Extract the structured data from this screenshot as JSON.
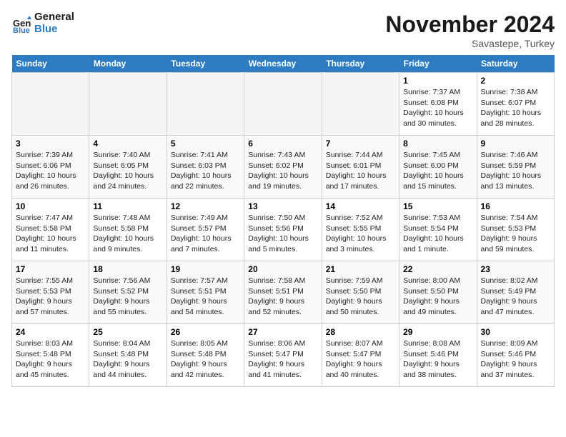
{
  "header": {
    "logo_line1": "General",
    "logo_line2": "Blue",
    "month": "November 2024",
    "location": "Savastepe, Turkey"
  },
  "days_of_week": [
    "Sunday",
    "Monday",
    "Tuesday",
    "Wednesday",
    "Thursday",
    "Friday",
    "Saturday"
  ],
  "weeks": [
    [
      {
        "day": "",
        "info": ""
      },
      {
        "day": "",
        "info": ""
      },
      {
        "day": "",
        "info": ""
      },
      {
        "day": "",
        "info": ""
      },
      {
        "day": "",
        "info": ""
      },
      {
        "day": "1",
        "info": "Sunrise: 7:37 AM\nSunset: 6:08 PM\nDaylight: 10 hours and 30 minutes."
      },
      {
        "day": "2",
        "info": "Sunrise: 7:38 AM\nSunset: 6:07 PM\nDaylight: 10 hours and 28 minutes."
      }
    ],
    [
      {
        "day": "3",
        "info": "Sunrise: 7:39 AM\nSunset: 6:06 PM\nDaylight: 10 hours and 26 minutes."
      },
      {
        "day": "4",
        "info": "Sunrise: 7:40 AM\nSunset: 6:05 PM\nDaylight: 10 hours and 24 minutes."
      },
      {
        "day": "5",
        "info": "Sunrise: 7:41 AM\nSunset: 6:03 PM\nDaylight: 10 hours and 22 minutes."
      },
      {
        "day": "6",
        "info": "Sunrise: 7:43 AM\nSunset: 6:02 PM\nDaylight: 10 hours and 19 minutes."
      },
      {
        "day": "7",
        "info": "Sunrise: 7:44 AM\nSunset: 6:01 PM\nDaylight: 10 hours and 17 minutes."
      },
      {
        "day": "8",
        "info": "Sunrise: 7:45 AM\nSunset: 6:00 PM\nDaylight: 10 hours and 15 minutes."
      },
      {
        "day": "9",
        "info": "Sunrise: 7:46 AM\nSunset: 5:59 PM\nDaylight: 10 hours and 13 minutes."
      }
    ],
    [
      {
        "day": "10",
        "info": "Sunrise: 7:47 AM\nSunset: 5:58 PM\nDaylight: 10 hours and 11 minutes."
      },
      {
        "day": "11",
        "info": "Sunrise: 7:48 AM\nSunset: 5:58 PM\nDaylight: 10 hours and 9 minutes."
      },
      {
        "day": "12",
        "info": "Sunrise: 7:49 AM\nSunset: 5:57 PM\nDaylight: 10 hours and 7 minutes."
      },
      {
        "day": "13",
        "info": "Sunrise: 7:50 AM\nSunset: 5:56 PM\nDaylight: 10 hours and 5 minutes."
      },
      {
        "day": "14",
        "info": "Sunrise: 7:52 AM\nSunset: 5:55 PM\nDaylight: 10 hours and 3 minutes."
      },
      {
        "day": "15",
        "info": "Sunrise: 7:53 AM\nSunset: 5:54 PM\nDaylight: 10 hours and 1 minute."
      },
      {
        "day": "16",
        "info": "Sunrise: 7:54 AM\nSunset: 5:53 PM\nDaylight: 9 hours and 59 minutes."
      }
    ],
    [
      {
        "day": "17",
        "info": "Sunrise: 7:55 AM\nSunset: 5:53 PM\nDaylight: 9 hours and 57 minutes."
      },
      {
        "day": "18",
        "info": "Sunrise: 7:56 AM\nSunset: 5:52 PM\nDaylight: 9 hours and 55 minutes."
      },
      {
        "day": "19",
        "info": "Sunrise: 7:57 AM\nSunset: 5:51 PM\nDaylight: 9 hours and 54 minutes."
      },
      {
        "day": "20",
        "info": "Sunrise: 7:58 AM\nSunset: 5:51 PM\nDaylight: 9 hours and 52 minutes."
      },
      {
        "day": "21",
        "info": "Sunrise: 7:59 AM\nSunset: 5:50 PM\nDaylight: 9 hours and 50 minutes."
      },
      {
        "day": "22",
        "info": "Sunrise: 8:00 AM\nSunset: 5:50 PM\nDaylight: 9 hours and 49 minutes."
      },
      {
        "day": "23",
        "info": "Sunrise: 8:02 AM\nSunset: 5:49 PM\nDaylight: 9 hours and 47 minutes."
      }
    ],
    [
      {
        "day": "24",
        "info": "Sunrise: 8:03 AM\nSunset: 5:48 PM\nDaylight: 9 hours and 45 minutes."
      },
      {
        "day": "25",
        "info": "Sunrise: 8:04 AM\nSunset: 5:48 PM\nDaylight: 9 hours and 44 minutes."
      },
      {
        "day": "26",
        "info": "Sunrise: 8:05 AM\nSunset: 5:48 PM\nDaylight: 9 hours and 42 minutes."
      },
      {
        "day": "27",
        "info": "Sunrise: 8:06 AM\nSunset: 5:47 PM\nDaylight: 9 hours and 41 minutes."
      },
      {
        "day": "28",
        "info": "Sunrise: 8:07 AM\nSunset: 5:47 PM\nDaylight: 9 hours and 40 minutes."
      },
      {
        "day": "29",
        "info": "Sunrise: 8:08 AM\nSunset: 5:46 PM\nDaylight: 9 hours and 38 minutes."
      },
      {
        "day": "30",
        "info": "Sunrise: 8:09 AM\nSunset: 5:46 PM\nDaylight: 9 hours and 37 minutes."
      }
    ]
  ]
}
